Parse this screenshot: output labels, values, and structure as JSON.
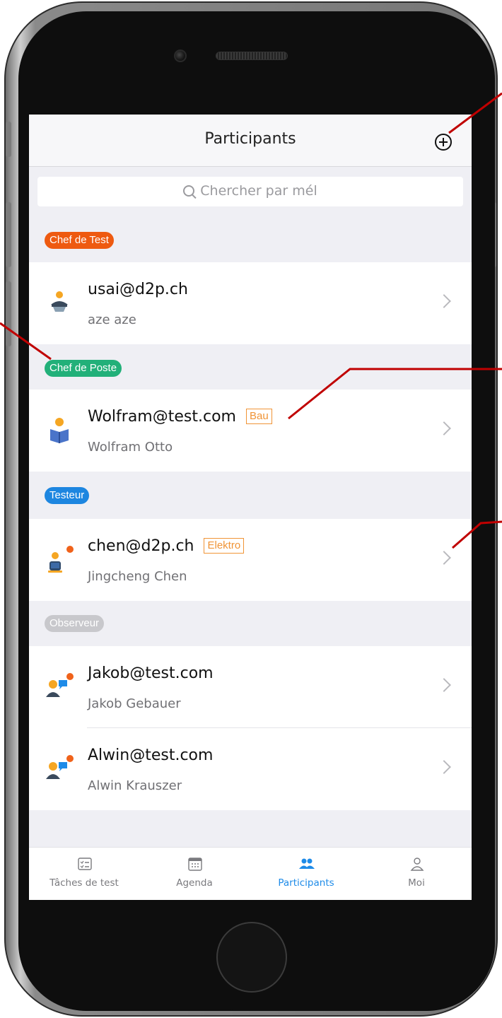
{
  "nav": {
    "title": "Participants",
    "add_icon": "plus-circle-icon"
  },
  "search": {
    "placeholder": "Chercher par mél",
    "icon": "search-icon"
  },
  "sections": [
    {
      "role": "Chef de Test",
      "badge_color": "#ee5a10",
      "participants": [
        {
          "email": "usai@d2p.ch",
          "name": "aze aze",
          "tag": "",
          "avatar": "chef-de-test-avatar-icon"
        }
      ]
    },
    {
      "role": "Chef de Poste",
      "badge_color": "#22b079",
      "participants": [
        {
          "email": "Wolfram@test.com",
          "name": "Wolfram Otto",
          "tag": "Bau",
          "avatar": "reader-avatar-icon"
        }
      ]
    },
    {
      "role": "Testeur",
      "badge_color": "#1d86e0",
      "participants": [
        {
          "email": "chen@d2p.ch",
          "name": "Jingcheng Chen",
          "tag": "Elektro",
          "avatar": "tester-avatar-icon"
        }
      ]
    },
    {
      "role": "Observeur",
      "badge_color": "#c8c8cc",
      "participants": [
        {
          "email": "Jakob@test.com",
          "name": "Jakob Gebauer",
          "tag": "",
          "avatar": "observer-avatar-icon"
        },
        {
          "email": "Alwin@test.com",
          "name": "Alwin Krauszer",
          "tag": "",
          "avatar": "observer-avatar-icon"
        }
      ]
    }
  ],
  "tabs": [
    {
      "label": "Tâches de test",
      "icon": "task-list-icon",
      "active": false
    },
    {
      "label": "Agenda",
      "icon": "calendar-icon",
      "active": false
    },
    {
      "label": "Participants",
      "icon": "participants-icon",
      "active": true
    },
    {
      "label": "Moi",
      "icon": "person-icon",
      "active": false
    }
  ],
  "colors": {
    "accent": "#1e8be8",
    "tag_orange": "#f09436",
    "status_dot": "#f0621a",
    "annotation_line": "#c00000"
  }
}
